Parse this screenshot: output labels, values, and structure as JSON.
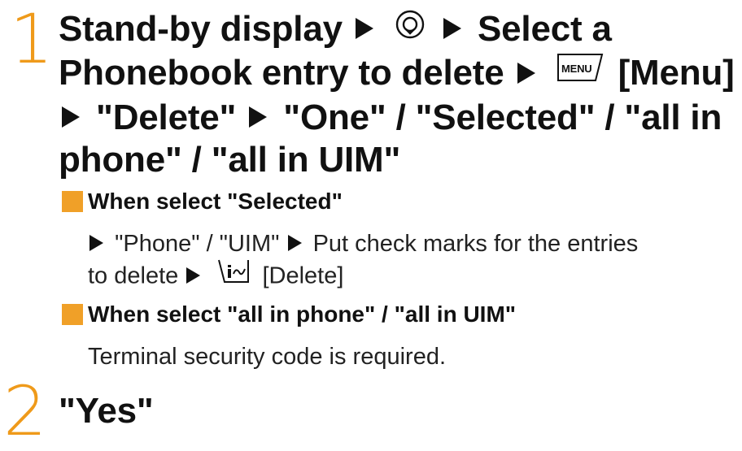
{
  "step1": {
    "number": "1",
    "line1_part1": "Stand-by display",
    "line1_part2": "Select a",
    "line2_part1": "Phonebook entry to delete",
    "line2_key": "MENU",
    "line2_part2": "[Menu]",
    "line3": "\"Delete\"",
    "line3_part2": "\"One\" / \"Selected\" / \"all in",
    "line4": "phone\" / \"all in UIM\""
  },
  "selected_section": {
    "heading": "When select \"Selected\"",
    "line1": "\"Phone\" / \"UIM\"",
    "line1_part2": "Put check marks for the entries",
    "line2_part1": "to delete",
    "line2_part2": "[Delete]"
  },
  "all_section": {
    "heading": "When select \"all in phone\" / \"all in UIM\"",
    "text": "Terminal security code is required."
  },
  "step2": {
    "number": "2",
    "text": "\"Yes\""
  },
  "colors": {
    "accent": "#ef9a1a",
    "text": "#111111"
  }
}
